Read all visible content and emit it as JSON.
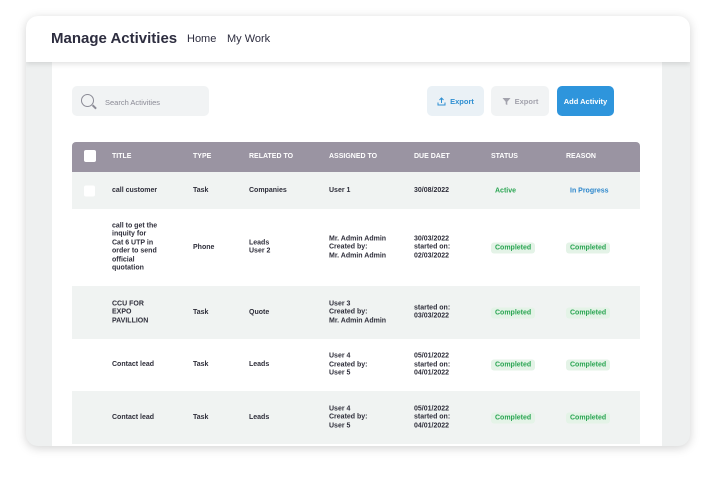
{
  "header": {
    "title": "Manage Activities",
    "nav": [
      "Home",
      "My Work"
    ]
  },
  "search": {
    "placeholder": "Search Activities"
  },
  "toolbar": {
    "export_label": "Export",
    "export_filtered_label": "Export",
    "add_label": "Add Activity"
  },
  "table": {
    "columns": [
      "TITLE",
      "TYPE",
      "RELATED TO",
      "ASSIGNED TO",
      "DUE DAET",
      "STATUS",
      "REASON"
    ],
    "rows": [
      {
        "title": [
          "call customer"
        ],
        "type": "Task",
        "related": [
          "Companies"
        ],
        "assigned": [
          "User 1"
        ],
        "due": [
          "30/08/2022"
        ],
        "status": "Active",
        "reason": "In Progress"
      },
      {
        "title": [
          "call  to get the",
          "inquity for",
          "Cat 6 UTP in",
          "order to send",
          "official",
          "quotation"
        ],
        "type": "Phone",
        "related": [
          "Leads",
          "User 2"
        ],
        "assigned": [
          "Mr. Admin Admin",
          "Created by:",
          "Mr. Admin Admin"
        ],
        "due": [
          "30/03/2022",
          "started on:",
          "02/03/2022"
        ],
        "status": "Completed",
        "reason": "Completed"
      },
      {
        "title": [
          "CCU FOR",
          "EXPO",
          "PAVILLION"
        ],
        "type": "Task",
        "related": [
          "Quote"
        ],
        "assigned": [
          "User 3",
          "Created by:",
          "Mr. Admin Admin"
        ],
        "due": [
          "started on:",
          "03/03/2022"
        ],
        "status": "Completed",
        "reason": "Completed"
      },
      {
        "title": [
          "Contact lead"
        ],
        "type": "Task",
        "related": [
          "Leads"
        ],
        "assigned": [
          "User 4",
          "Created by:",
          "User 5"
        ],
        "due": [
          "05/01/2022",
          "started on:",
          "04/01/2022"
        ],
        "status": "Completed",
        "reason": "Completed"
      },
      {
        "title": [
          "Contact lead"
        ],
        "type": "Task",
        "related": [
          "Leads"
        ],
        "assigned": [
          "User 4",
          "Created by:",
          "User 5"
        ],
        "due": [
          "05/01/2022",
          "started on:",
          "04/01/2022"
        ],
        "status": "Completed",
        "reason": "Completed"
      }
    ]
  },
  "colors": {
    "accent": "#2e95dc",
    "table_header": "#9a94a2",
    "status_green": "#2aa552"
  }
}
